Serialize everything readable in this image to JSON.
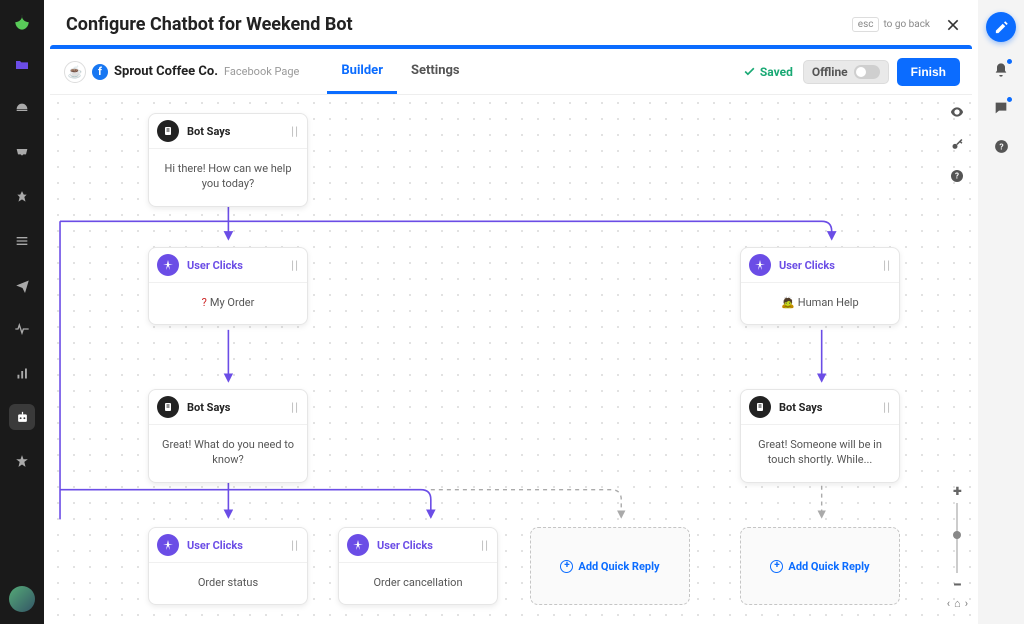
{
  "modal": {
    "title": "Configure Chatbot for Weekend Bot",
    "esc_key": "esc",
    "go_back": "to go back"
  },
  "page": {
    "name": "Sprout Coffee Co.",
    "subtype": "Facebook Page"
  },
  "tabs": {
    "builder": "Builder",
    "settings": "Settings"
  },
  "status": {
    "saved": "Saved",
    "offline": "Offline",
    "finish": "Finish"
  },
  "nodes": {
    "bot_says_label": "Bot Says",
    "user_clicks_label": "User Clicks",
    "intro": "Hi there! How can we help you today?",
    "my_order": "My Order",
    "human_help": "Human Help",
    "followup_order": "Great! What do you need to know?",
    "followup_human": "Great! Someone will be in touch shortly. While...",
    "order_status": "Order status",
    "order_cancel": "Order cancellation",
    "add_quick_reply": "Add Quick Reply"
  },
  "left_rail": {
    "items": [
      "folder",
      "dashboard",
      "inbox",
      "pin",
      "list",
      "send",
      "pulse",
      "bars",
      "bot",
      "star"
    ]
  },
  "right_gutter": {
    "items": [
      "compose",
      "bell",
      "chat",
      "help"
    ]
  }
}
